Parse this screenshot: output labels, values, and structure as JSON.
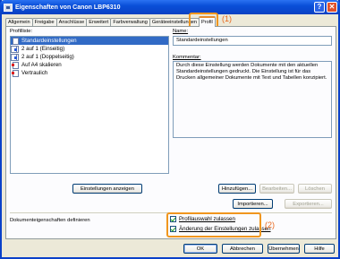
{
  "window": {
    "title": "Eigenschaften von Canon LBP6310"
  },
  "tabs": [
    {
      "label": "Allgemein"
    },
    {
      "label": "Freigabe"
    },
    {
      "label": "Anschlüsse"
    },
    {
      "label": "Erweitert"
    },
    {
      "label": "Farbverwaltung"
    },
    {
      "label": "Geräteeinstellungen"
    },
    {
      "label": "Profil"
    }
  ],
  "callouts": {
    "one": "(1)",
    "two": "(2)"
  },
  "profile_list": {
    "label": "Profilliste:",
    "items": [
      {
        "label": "Standardeinstellungen",
        "icon": "document-icon"
      },
      {
        "label": "2 auf 1 (Einseitig)",
        "icon": "two-pages-icon"
      },
      {
        "label": "2 auf 1 (Doppelseitig)",
        "icon": "two-pages-duplex-icon"
      },
      {
        "label": "Auf A4 skalieren",
        "icon": "scale-a4-icon"
      },
      {
        "label": "Vertraulich",
        "icon": "confidential-icon"
      }
    ]
  },
  "name": {
    "label": "Name:",
    "value": "Standardeinstellungen"
  },
  "comment": {
    "label": "Kommentar:",
    "value": "Durch diese Einstellung werden Dokumente mit den aktuellen Standardeinstellungen gedruckt. Die Einstellung ist für das Drucken allgemeiner Dokumente mit Text und Tabellen konzipiert."
  },
  "buttons": {
    "show_settings": "Einstellungen anzeigen",
    "add": "Hinzufügen...",
    "edit": "Bearbeiten...",
    "delete": "Löschen",
    "import": "Importieren...",
    "export": "Exportieren...",
    "ok": "OK",
    "cancel": "Abbrechen",
    "apply": "Übernehmen",
    "help": "Hilfe"
  },
  "doc_props": {
    "label": "Dokumenteigenschaften definieren",
    "allow_profile_selection": "Profilauswahl zulassen",
    "allow_settings_change": "Änderung der Einstellungen zulassen"
  }
}
